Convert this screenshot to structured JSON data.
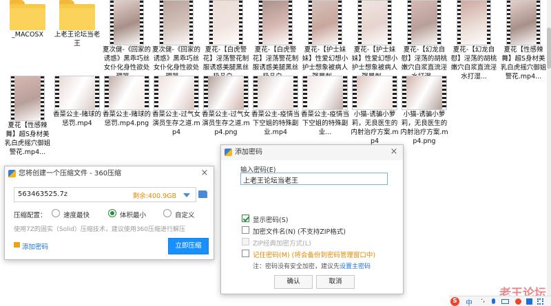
{
  "files_row1": [
    {
      "name": "_MACOSX",
      "kind": "folder"
    },
    {
      "name": "上老王论坛当老王",
      "kind": "folder"
    },
    {
      "name": "夏次健-《回家的诱惑》黑乖巧丝女仆化身性欲处理器 ...",
      "kind": "portrait"
    },
    {
      "name": "夏次健-《回家的诱惑》黑乖巧丝女仆化身性欲处理器 ...",
      "kind": "portrait"
    },
    {
      "name": "夏花-【白虎警花】淫荡警花制服诱惑美腿黑丝极品白...",
      "kind": "portrait"
    },
    {
      "name": "夏花-【白虎警花】淫荡警花制服诱惑美腿黑丝极品白...",
      "kind": "portrait"
    },
    {
      "name": "夏花-【护士妹妹】性爱幻想小护士想象被病人强暴刺...",
      "kind": "portrait"
    },
    {
      "name": "夏花-【护士妹妹】性爱幻想小护士想象被病人强暴刺...",
      "kind": "portrait"
    },
    {
      "name": "夏花-【幻龙自慰】淫荡的胡桃嫩穴白浆直流淫水打湿...",
      "kind": "portrait"
    },
    {
      "name": "夏花-【幻龙自慰】淫荡的胡桃嫩穴白浆直流淫水打湿...",
      "kind": "portrait"
    },
    {
      "name": "夏花【性感辣舞】超S身材美乳白虎摇穴御姐警花.mp4...",
      "kind": "portrait"
    }
  ],
  "files_row2": [
    {
      "name": "夏花【性感辣舞】超S身材美乳白虎摇穴御姐警花.mp4...",
      "kind": "portrait"
    },
    {
      "name": "香菜公主-赌球的惩罚.mp4",
      "kind": "landscape"
    },
    {
      "name": "香菜公主-赌球的惩罚.mp4.png",
      "kind": "landscape"
    },
    {
      "name": "香菜公主-过气女演员生存之道.mp4",
      "kind": "landscape"
    },
    {
      "name": "香菜公主-过气女演员生存之道.mp4.png",
      "kind": "landscape"
    },
    {
      "name": "香菜公主-疫情当下空姐的特殊副业.mp4",
      "kind": "landscape"
    },
    {
      "name": "香菜公主-疫情当下空姐的特殊副业...",
      "kind": "landscape"
    },
    {
      "name": "小猫-诱骗小萝莉，无良医生的内射治疗方案.mp4",
      "kind": "landscape"
    },
    {
      "name": "小猫-诱骗小萝莉，无良医生的内射治疗方案.mp4.png",
      "kind": "landscape"
    }
  ],
  "compress": {
    "title": "您将创建一个压缩文件 - 360压缩",
    "filename": "563463525.7z",
    "remaining": "剩余:400.9GB",
    "config_label": "压缩配置：",
    "options": [
      "速度最快",
      "体积最小",
      "自定义"
    ],
    "selected": 1,
    "hint": "使用7Z的固实（Solid）压缩技术，建议使用360压缩进行解压",
    "add_password": "添加密码",
    "start": "立即压缩"
  },
  "password": {
    "title": "添加密码",
    "input_label": "输入密码(E)",
    "value": "上老王论坛当老王",
    "show_password": "显示密码(S)",
    "encrypt_names": "加密文件名(N) (不支持ZIP格式)",
    "zip_classic": "ZIP经典加密方式(L)",
    "remember": "记住密码(M) (将会备份到密码管理窗口中)",
    "note_prefix": "注：密码没有安全加密，建议先",
    "note_link": "设置主密码",
    "ok": "确认",
    "cancel": "取消"
  },
  "watermark": "老王论坛",
  "colors": {
    "accent": "#1890ff",
    "green": "#2a8a38",
    "link": "#1d6fd8",
    "orange": "#f0a020"
  }
}
